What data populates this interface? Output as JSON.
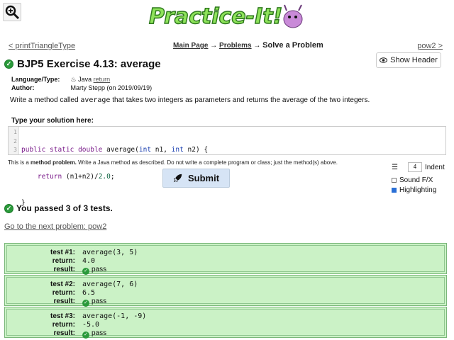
{
  "header": {
    "logo_text": "Practice-It!",
    "prev_link": "< printTriangleType",
    "next_link": "pow2 >",
    "breadcrumb": {
      "main": "Main Page",
      "problems": "Problems",
      "arrow": "→",
      "current": "Solve a Problem"
    },
    "show_header": "Show Header"
  },
  "problem": {
    "title": "BJP5 Exercise 4.13: average",
    "language_label": "Language/Type:",
    "language_value": "Java",
    "language_type": "return",
    "author_label": "Author:",
    "author_value": "Marty Stepp (on 2019/09/19)",
    "description_pre": "Write a method called ",
    "description_code": "average",
    "description_post": " that takes two integers as parameters and returns the average of the two integers."
  },
  "editor": {
    "label": "Type your solution here:",
    "line_numbers": [
      "1",
      "2",
      "3"
    ],
    "lines": [
      [
        "public static double ",
        "average(",
        "int ",
        "n1, ",
        "int ",
        "n2) {"
      ],
      [
        "    return ",
        "(n1+n2)/",
        "2.0",
        ";"
      ],
      [
        "}"
      ]
    ]
  },
  "method_note": {
    "pre": "This is a ",
    "bold": "method problem.",
    "post": " Write a Java method as described. Do not write a complete program or class; just the method(s) above."
  },
  "submit_label": "Submit",
  "options": {
    "indent_value": "4",
    "indent_label": "Indent",
    "sound_label": "Sound F/X",
    "sound_checked": false,
    "highlight_label": "Highlighting",
    "highlight_checked": true
  },
  "results": {
    "summary": "You passed 3 of 3 tests.",
    "next_problem": "Go to the next problem: pow2",
    "tests": [
      {
        "label": "test #1:",
        "call": "average(3, 5)",
        "return_label": "return:",
        "return": "4.0",
        "result_label": "result:",
        "result": "pass"
      },
      {
        "label": "test #2:",
        "call": "average(7, 6)",
        "return_label": "return:",
        "return": "6.5",
        "result_label": "result:",
        "result": "pass"
      },
      {
        "label": "test #3:",
        "call": "average(-1, -9)",
        "return_label": "return:",
        "return": "-5.0",
        "result_label": "result:",
        "result": "pass"
      }
    ]
  }
}
